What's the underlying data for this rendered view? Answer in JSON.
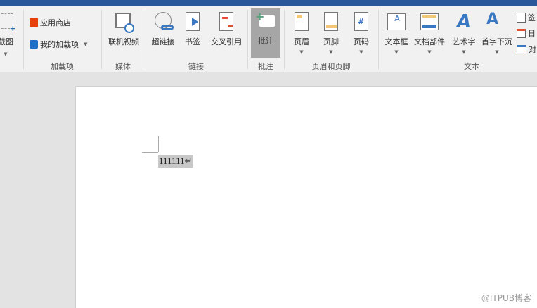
{
  "ribbon": {
    "screenshot": {
      "label": "屏幕截图"
    },
    "addins": {
      "store": "应用商店",
      "my_addins": "我的加载项",
      "group": "加载项"
    },
    "media": {
      "online_video": "联机视频",
      "group": "媒体"
    },
    "links": {
      "hyperlink": "超链接",
      "bookmark": "书签",
      "cross_ref": "交叉引用",
      "group": "链接"
    },
    "comments": {
      "comment": "批注",
      "group": "批注"
    },
    "header_footer": {
      "header": "页眉",
      "footer": "页脚",
      "page_number": "页码",
      "group": "页眉和页脚"
    },
    "text": {
      "textbox": "文本框",
      "quick_parts": "文档部件",
      "wordart": "艺术字",
      "dropcap": "首字下沉",
      "signature": "签",
      "datetime": "日",
      "object": "对",
      "group": "文本"
    }
  },
  "document": {
    "text": "111111↵"
  },
  "watermark": "@ITPUB博客",
  "colors": {
    "titlebar": "#2b579a",
    "accent": "#4a7ebb",
    "highlight": "#a6a6a6"
  }
}
